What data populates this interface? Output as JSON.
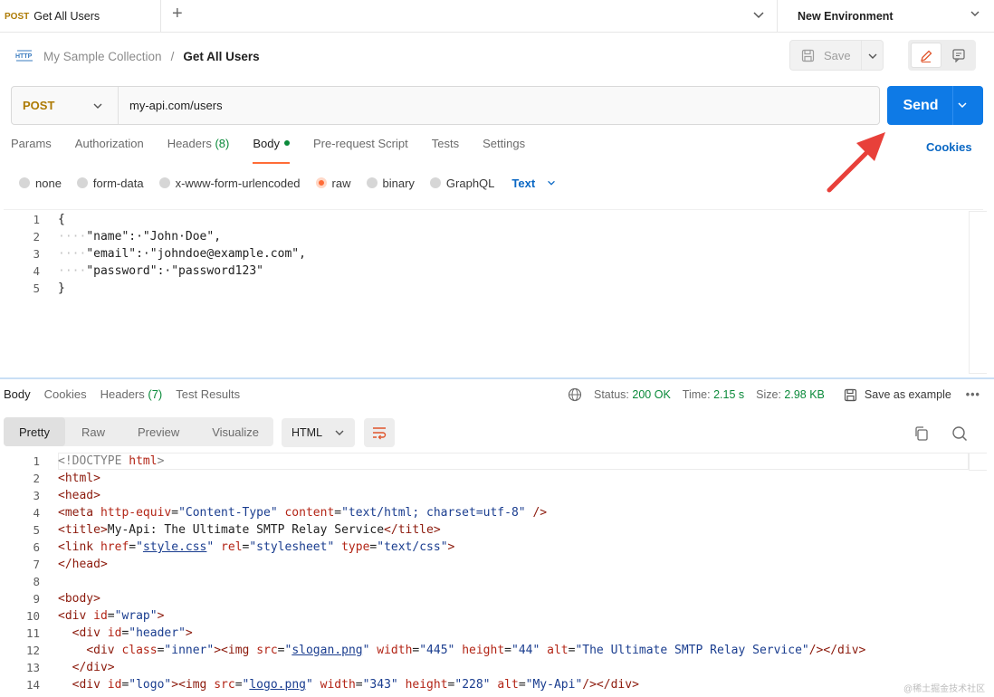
{
  "tab": {
    "method": "POST",
    "title": "Get All Users"
  },
  "environment": {
    "label": "New Environment"
  },
  "breadcrumb": {
    "parent": "My Sample Collection",
    "separator": "/",
    "current": "Get All Users"
  },
  "toolbar": {
    "save_label": "Save"
  },
  "request": {
    "method": "POST",
    "url": "my-api.com/users",
    "send_label": "Send"
  },
  "req_tabs": [
    {
      "label": "Params"
    },
    {
      "label": "Authorization"
    },
    {
      "label": "Headers",
      "count": "(8)"
    },
    {
      "label": "Body"
    },
    {
      "label": "Pre-request Script"
    },
    {
      "label": "Tests"
    },
    {
      "label": "Settings"
    }
  ],
  "cookies_label": "Cookies",
  "body_types": [
    {
      "label": "none"
    },
    {
      "label": "form-data"
    },
    {
      "label": "x-www-form-urlencoded"
    },
    {
      "label": "raw",
      "selected": true
    },
    {
      "label": "binary"
    },
    {
      "label": "GraphQL"
    }
  ],
  "raw_format": "Text",
  "request_body": [
    {
      "n": "1",
      "text": "{"
    },
    {
      "n": "2",
      "indent": "····",
      "text": "\"name\":·\"John·Doe\","
    },
    {
      "n": "3",
      "indent": "····",
      "text": "\"email\":·\"johndoe@example.com\","
    },
    {
      "n": "4",
      "indent": "····",
      "text": "\"password\":·\"password123\""
    },
    {
      "n": "5",
      "text": "}"
    }
  ],
  "response": {
    "tabs": [
      {
        "label": "Body"
      },
      {
        "label": "Cookies"
      },
      {
        "label": "Headers",
        "count": "(7)"
      },
      {
        "label": "Test Results"
      }
    ],
    "status_label": "Status:",
    "status_value": "200 OK",
    "time_label": "Time:",
    "time_value": "2.15 s",
    "size_label": "Size:",
    "size_value": "2.98 KB",
    "save_example_label": "Save as example",
    "more_label": "•••",
    "views": [
      "Pretty",
      "Raw",
      "Preview",
      "Visualize"
    ],
    "language": "HTML",
    "line_numbers": [
      "1",
      "2",
      "3",
      "4",
      "5",
      "6",
      "7",
      "8",
      "9",
      "10",
      "11",
      "12",
      "13",
      "14"
    ]
  },
  "icons": {
    "http": "http-icon",
    "save": "floppy-icon",
    "edit": "pencil-icon",
    "docs": "comment-icon",
    "globe": "globe-icon",
    "copy": "copy-icon",
    "search": "search-icon",
    "wrap": "wrap-lines-icon"
  },
  "colors": {
    "accent": "#ff6c37",
    "send": "#0e7ae6",
    "post_method": "#ad7a03",
    "status_ok": "#0a8a3a",
    "link": "#0b68c4",
    "annotation_arrow": "#e8403a"
  },
  "watermark": "@稀土掘金技术社区"
}
